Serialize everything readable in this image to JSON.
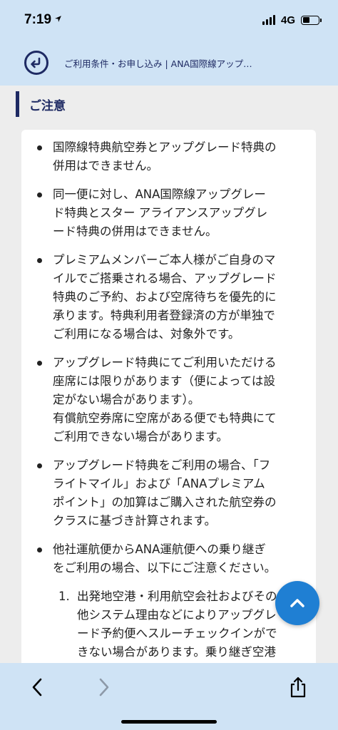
{
  "status_bar": {
    "time": "7:19",
    "network": "4G"
  },
  "header": {
    "title": "ご利用条件・お申し込み | ANA国際線アップ…"
  },
  "section": {
    "title": "ご注意"
  },
  "notes": [
    "国際線特典航空券とアップグレード特典の\n併用はできません。",
    "同一便に対し、ANA国際線アップグレー\nド特典とスター アライアンスアップグレ\nード特典の併用はできません。",
    "プレミアムメンバーご本人様がご自身のマ\nイルでご搭乗される場合、アップグレード\n特典のご予約、および空席待ちを優先的に\n承ります。特典利用者登録済の方が単独で\nご利用になる場合は、対象外です。",
    "アップグレード特典にてご利用いただける\n座席には限りがあります（便によっては設\n定がない場合があります）。\n有償航空券席に空席がある便でも特典にて\nご利用できない場合があります。",
    "アップグレード特典をご利用の場合、「フ\nライトマイル」および「ANAプレミアム\nポイント」の加算はご購入された航空券の\nクラスに基づき計算されます。",
    "他社運航便からANA運航便への乗り継ぎ\nをご利用の場合、以下にご注意ください。"
  ],
  "sub_notes": [
    {
      "number": "1.",
      "text": "出発地空港・利用航空会社およびその\n他システム理由などによりアップグレ\nード予約便へスルーチェックインがで\nきない場合があります。乗り継ぎ空港"
    }
  ],
  "colors": {
    "header_bg": "#cfe3f5",
    "brand_navy": "#1e2a63",
    "page_bg": "#ededed",
    "fab_blue": "#1f7fd3"
  },
  "icons": {
    "back": "back-arrow-circle-icon",
    "scroll_top": "chevron-up-icon",
    "browser_back": "chevron-left-icon",
    "browser_forward": "chevron-right-icon",
    "share": "share-icon"
  }
}
